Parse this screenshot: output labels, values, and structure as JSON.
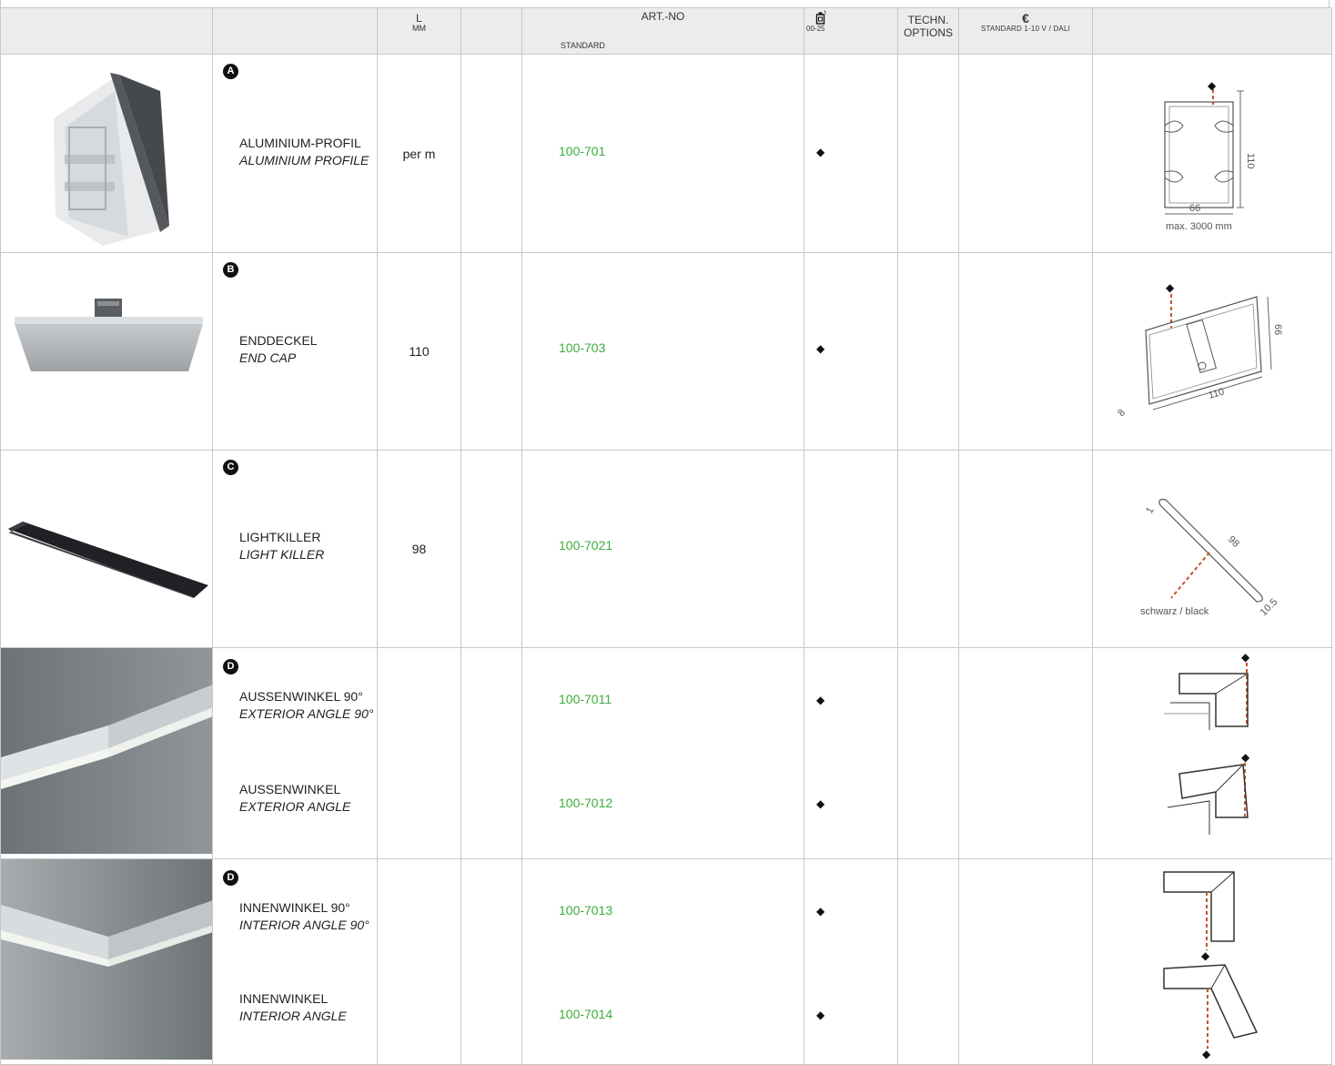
{
  "header": {
    "l_label": "L",
    "l_unit": "MM",
    "artno_label": "ART.-NO",
    "artno_sub": "STANDARD",
    "paint_code": "00-25",
    "techn_line1": "TECHN.",
    "techn_line2": "OPTIONS",
    "price_symbol": "€",
    "price_sub": "STANDARD  1-10 V / DALI"
  },
  "rows": [
    {
      "badge": "A",
      "name_de": "ALUMINIUM-PROFIL",
      "name_en": "ALUMINIUM PROFILE",
      "length": "per m",
      "art_no": "100-701",
      "paint_mark": "◆",
      "dim_width": "66",
      "dim_height": "110",
      "dim_note": "max. 3000 mm"
    },
    {
      "badge": "B",
      "name_de": "ENDDECKEL",
      "name_en": "END CAP",
      "length": "110",
      "art_no": "100-703",
      "paint_mark": "◆",
      "dim_height": "66",
      "dim_length": "110",
      "dim_depth": "8"
    },
    {
      "badge": "C",
      "name_de": "LIGHTKILLER",
      "name_en": "LIGHT KILLER",
      "length": "98",
      "art_no": "100-7021",
      "dim_t": "1",
      "dim_l": "98",
      "dim_w": "10.5",
      "dim_note": "schwarz / black"
    },
    {
      "badge": "D",
      "items": [
        {
          "name_de": "AUSSENWINKEL 90°",
          "name_en": "EXTERIOR ANGLE 90°",
          "art_no": "100-7011",
          "paint_mark": "◆"
        },
        {
          "name_de": "AUSSENWINKEL",
          "name_en": "EXTERIOR ANGLE",
          "art_no": "100-7012",
          "paint_mark": "◆"
        }
      ]
    },
    {
      "badge": "D",
      "items": [
        {
          "name_de": "INNENWINKEL 90°",
          "name_en": "INTERIOR ANGLE 90°",
          "art_no": "100-7013",
          "paint_mark": "◆"
        },
        {
          "name_de": "INNENWINKEL",
          "name_en": "INTERIOR ANGLE",
          "art_no": "100-7014",
          "paint_mark": "◆"
        }
      ]
    }
  ]
}
